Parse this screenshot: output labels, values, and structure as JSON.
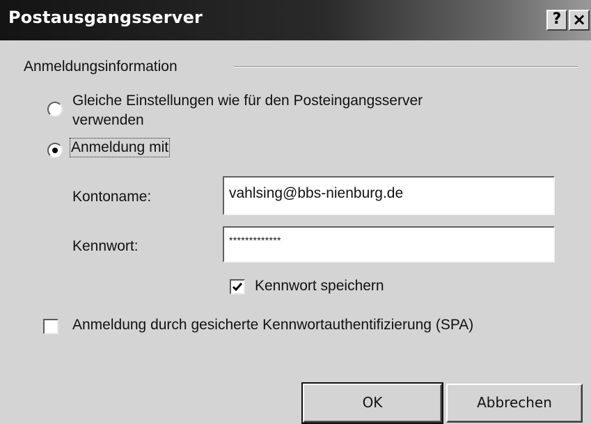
{
  "window": {
    "title": "Postausgangsserver",
    "help_label": "?",
    "close_label": "×"
  },
  "group": {
    "label": "Anmeldungsinformation"
  },
  "options": {
    "same_settings_line1": "Gleiche Einstellungen wie für den Posteingangsserver",
    "same_settings_line2": "verwenden",
    "same_settings_selected": false,
    "login_with": "Anmeldung mit",
    "login_with_selected": true
  },
  "form": {
    "account_label": "Kontoname:",
    "account_value": "vahlsing@bbs-nienburg.de",
    "password_label": "Kennwort:",
    "password_value": "*************",
    "save_password_label": "Kennwort speichern",
    "save_password_checked": true,
    "spa_label": "Anmeldung durch gesicherte Kennwortauthentifizierung (SPA)",
    "spa_checked": false
  },
  "buttons": {
    "ok_label": "OK",
    "cancel_label": "Abbrechen"
  },
  "colors": {
    "dialog_bg": "#d4d4d4",
    "titlebar_dark": "#141414",
    "titlebar_light": "#9a9a9a",
    "field_bg": "#ffffff"
  }
}
